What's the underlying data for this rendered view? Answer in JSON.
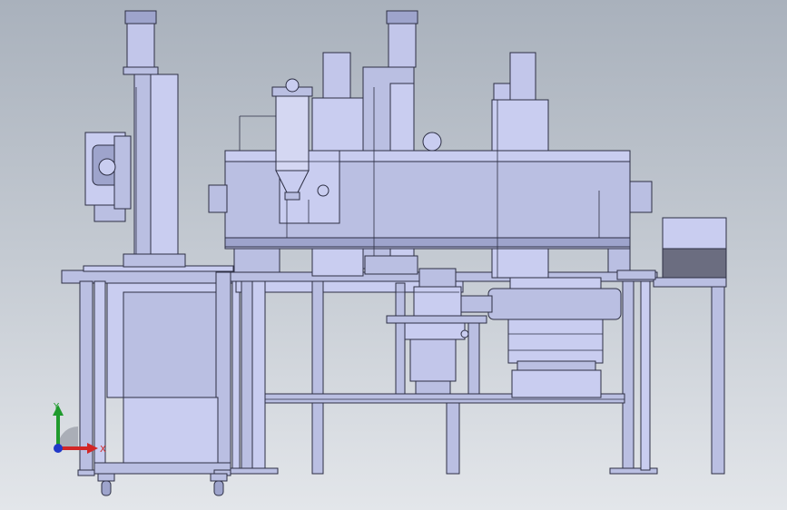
{
  "viewport": {
    "colors": {
      "body": "#babfe2",
      "body_light": "#c9cdf0",
      "body_dark": "#9ea4cc",
      "edge": "#2d2f44",
      "dark_panel": "#6b6d80",
      "motor": "#c2c6ea"
    }
  },
  "triad": {
    "y_label": "Y",
    "x_label": "X",
    "colors": {
      "x": "#d22626",
      "y": "#1f9a2d",
      "z": "#2038c8"
    }
  }
}
